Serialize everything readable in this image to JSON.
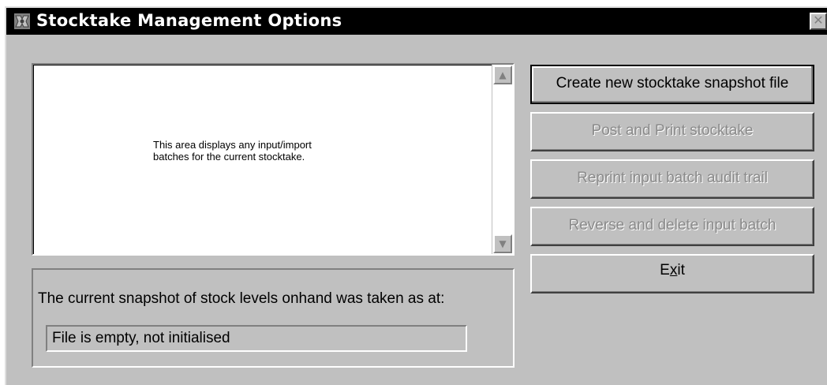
{
  "window": {
    "title": "Stocktake Management Options",
    "close_glyph": "✕"
  },
  "list": {
    "hint_line1": "This area displays any input/import",
    "hint_line2": "batches for the current stocktake.",
    "scroll_up_glyph": "▲",
    "scroll_down_glyph": "▼"
  },
  "snapshot": {
    "label": "The current snapshot of stock levels onhand was taken as at:",
    "value": "File is empty, not initialised"
  },
  "buttons": {
    "create": "Create new stocktake snapshot file",
    "post": "Post and Print stocktake",
    "reprint": "Reprint input batch audit trail",
    "reverse": "Reverse and delete input batch",
    "exit_pre": "E",
    "exit_mnemonic": "x",
    "exit_post": "it"
  },
  "colors": {
    "titlebar": "#000000",
    "face": "#c0c0c0",
    "disabled_text": "#8a8a8a"
  },
  "icons": {
    "app": "app-icon",
    "close": "close-icon"
  }
}
